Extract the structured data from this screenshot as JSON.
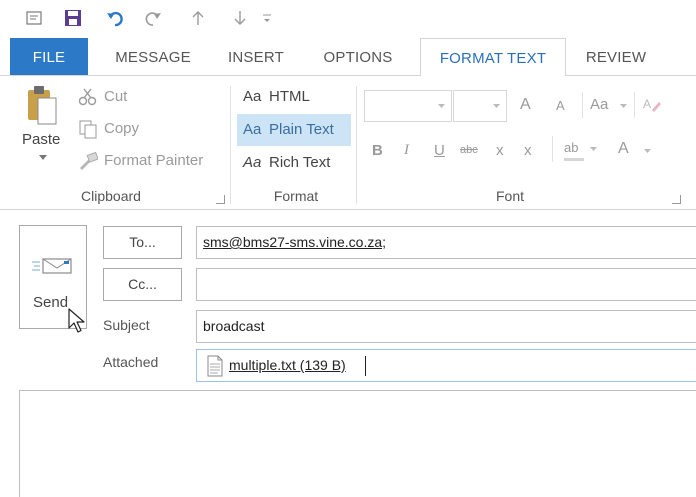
{
  "qat": {
    "icons": [
      "message-options-icon",
      "save-icon",
      "undo-icon",
      "redo-icon",
      "up-arrow-icon",
      "down-arrow-icon",
      "customize-qat-icon"
    ],
    "colors": {
      "save": "#5c3d8f",
      "undo": "#2b79c7",
      "gray": "#9a9a9a"
    }
  },
  "tabs": [
    {
      "label": "FILE"
    },
    {
      "label": "MESSAGE"
    },
    {
      "label": "INSERT"
    },
    {
      "label": "OPTIONS"
    },
    {
      "label": "FORMAT TEXT"
    },
    {
      "label": "REVIEW"
    }
  ],
  "active_tab": "FORMAT TEXT",
  "ribbon": {
    "clipboard": {
      "paste_label": "Paste",
      "cut_label": "Cut",
      "copy_label": "Copy",
      "format_painter_label": "Format Painter",
      "group_label": "Clipboard"
    },
    "format": {
      "html_prefix": "Aa",
      "html_label": "HTML",
      "plain_prefix": "Aa",
      "plain_label": "Plain Text",
      "rich_prefix": "Aa",
      "rich_label": "Rich Text",
      "group_label": "Format",
      "selected": "Plain Text"
    },
    "font": {
      "font_name_value": "",
      "font_size_value": "",
      "grow_label": "A",
      "shrink_label": "A",
      "change_case_label": "Aa",
      "bold_label": "B",
      "italic_label": "I",
      "underline_label": "U",
      "strikethrough_label": "abc",
      "subscript_label": "x",
      "superscript_label": "x",
      "highlight_label": "ab",
      "font_color_label": "A",
      "group_label": "Font"
    }
  },
  "compose": {
    "send_label": "Send",
    "to_button": "To...",
    "to_value": "sms@bms27-sms.vine.co.za;",
    "cc_button": "Cc...",
    "cc_value": "",
    "subject_label": "Subject",
    "subject_value": "broadcast",
    "attached_label": "Attached",
    "attachment_name": "multiple.txt (139 B)"
  },
  "colors": {
    "accent": "#2b79c7",
    "selected_bg": "#cde4f7",
    "border": "#a9a9a9"
  }
}
